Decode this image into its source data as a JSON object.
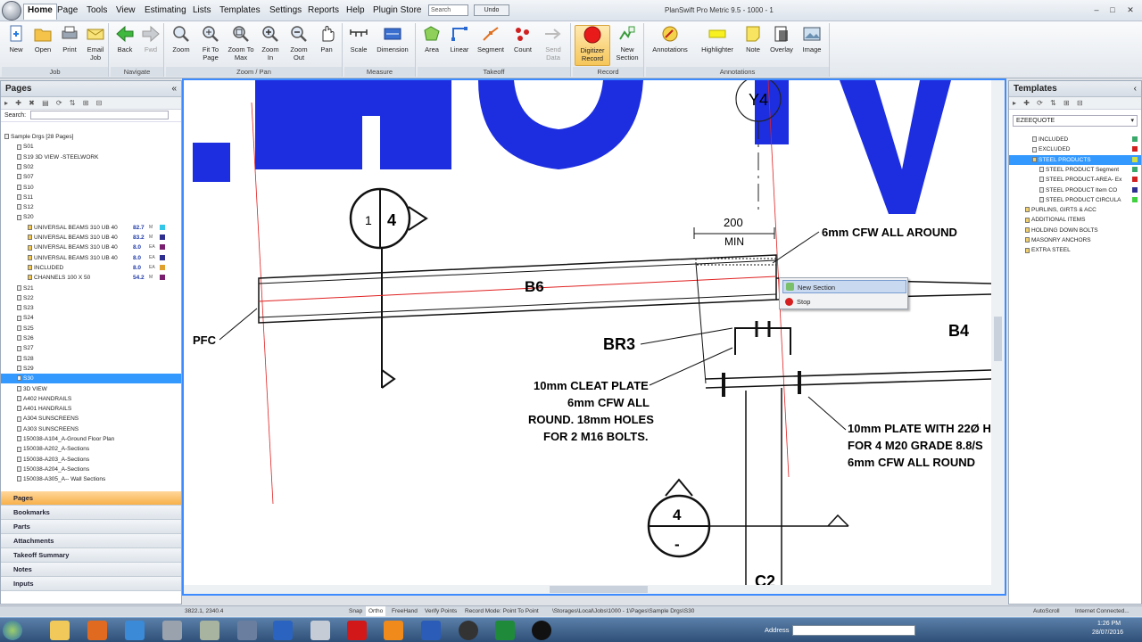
{
  "app": {
    "title": "PlanSwift Pro Metric 9.5 - 1000 - 1"
  },
  "menus": [
    "Home",
    "Page",
    "Tools",
    "View",
    "Estimating",
    "Lists",
    "Templates",
    "Settings",
    "Reports",
    "Help",
    "Plugin Store"
  ],
  "search": {
    "placeholder": "Search"
  },
  "undo_label": "Undo",
  "ribbon": {
    "groups": [
      {
        "label": "Job",
        "buttons": [
          "New",
          "Open",
          "Print",
          "Email Job"
        ]
      },
      {
        "label": "Navigate",
        "buttons": [
          "Back",
          "Fwd"
        ]
      },
      {
        "label": "Zoom / Pan",
        "buttons": [
          "Zoom",
          "Fit To Page",
          "Zoom To Max",
          "Zoom In",
          "Zoom Out",
          "Pan"
        ]
      },
      {
        "label": "Measure",
        "buttons": [
          "Scale",
          "Dimension"
        ]
      },
      {
        "label": "Takeoff",
        "buttons": [
          "Area",
          "Linear",
          "Segment",
          "Count",
          "Send Data"
        ]
      },
      {
        "label": "Record",
        "buttons": [
          "Digitizer Record",
          "New Section"
        ]
      },
      {
        "label": "Annotations",
        "buttons": [
          "Annotations",
          "Highlighter",
          "Note",
          "Overlay",
          "Image"
        ]
      }
    ]
  },
  "pages_panel": {
    "title": "Pages",
    "search_label": "Search:",
    "tree": [
      {
        "label": "Sample Drgs [28 Pages]"
      },
      {
        "label": "S01"
      },
      {
        "label": "S19 3D VIEW -STEELWORK"
      },
      {
        "label": "S02"
      },
      {
        "label": "S07"
      },
      {
        "label": "S10"
      },
      {
        "label": "S11"
      },
      {
        "label": "S12"
      },
      {
        "label": "S20"
      },
      {
        "label": "UNIVERSAL BEAMS 310 UB 40",
        "value": "82.7",
        "unit": "M",
        "color": "#33c6e8"
      },
      {
        "label": "UNIVERSAL BEAMS 310 UB 40",
        "value": "83.2",
        "unit": "M",
        "color": "#2f2f8f"
      },
      {
        "label": "UNIVERSAL BEAMS 310 UB 40",
        "value": "8.0",
        "unit": "EA",
        "color": "#7a1f6f"
      },
      {
        "label": "UNIVERSAL BEAMS 310 UB 40",
        "value": "8.0",
        "unit": "EA",
        "color": "#2f2f8f"
      },
      {
        "label": "INCLUDED",
        "value": "8.0",
        "unit": "EA",
        "color": "#e0a030"
      },
      {
        "label": "CHANNELS 100 X 50",
        "value": "54.2",
        "unit": "M",
        "color": "#7a1f6f"
      },
      {
        "label": "S21"
      },
      {
        "label": "S22"
      },
      {
        "label": "S23"
      },
      {
        "label": "S24"
      },
      {
        "label": "S25"
      },
      {
        "label": "S26"
      },
      {
        "label": "S27"
      },
      {
        "label": "S28"
      },
      {
        "label": "S29"
      },
      {
        "label": "S30"
      },
      {
        "label": "3D VIEW"
      },
      {
        "label": "A402 HANDRAILS"
      },
      {
        "label": "A401 HANDRAILS"
      },
      {
        "label": "A304 SUNSCREENS"
      },
      {
        "label": "A303 SUNSCREENS"
      },
      {
        "label": "150038-A104_A-Ground Floor Plan"
      },
      {
        "label": "150038-A202_A-Sections"
      },
      {
        "label": "150038-A203_A-Sections"
      },
      {
        "label": "150038-A204_A-Sections"
      },
      {
        "label": "150038-A305_A-- Wall Sections"
      }
    ],
    "accordion": [
      "Pages",
      "Bookmarks",
      "Parts",
      "Attachments",
      "Takeoff Summary",
      "Notes",
      "Inputs"
    ]
  },
  "templates_panel": {
    "title": "Templates",
    "dropdown": "EZEEQUOTE",
    "tree": [
      {
        "label": "INCLUDED",
        "color": "#3aa86a"
      },
      {
        "label": "EXCLUDED",
        "color": "#d02020"
      },
      {
        "label": "STEEL PRODUCTS",
        "color": "#d0e040"
      },
      {
        "label": "STEEL PRODUCT Segment",
        "color": "#3aa86a"
      },
      {
        "label": "STEEL PRODUCT-AREA- Ex",
        "color": "#d02020"
      },
      {
        "label": "STEEL PRODUCT  Item CO",
        "color": "#2f2f8f"
      },
      {
        "label": "STEEL PRODUCT CIRCULA",
        "color": "#40d040"
      },
      {
        "label": "PURLINS, GIRTS & ACC"
      },
      {
        "label": "ADDITIONAL ITEMS"
      },
      {
        "label": "HOLDING DOWN BOLTS"
      },
      {
        "label": "MASONRY ANCHORS"
      },
      {
        "label": "EXTRA STEEL"
      }
    ]
  },
  "drawing": {
    "labels": {
      "y4": "Y4",
      "dim200": "200",
      "min": "MIN",
      "cfw_around": "6mm CFW ALL AROUND",
      "b6": "B6",
      "pfc": "PFC",
      "br3": "BR3",
      "b4": "B4",
      "cleat1": "10mm CLEAT PLATE",
      "cleat2": "6mm CFW ALL",
      "cleat3": "ROUND. 18mm HOLES",
      "cleat4": "FOR 2 M16 BOLTS.",
      "plate1": "10mm PLATE WITH 22Ø H",
      "plate2": "FOR 4 M20 GRADE 8.8/S",
      "plate3": "6mm CFW ALL ROUND",
      "c2": "C2",
      "sec1": "1",
      "sec4": "4",
      "sec4b": "4",
      "sec_dash": "-"
    }
  },
  "context_menu": {
    "items": [
      "New Section",
      "Stop"
    ]
  },
  "status": {
    "coords": "3822.1, 2340.4",
    "snap": "Snap",
    "ortho": "Ortho",
    "freehand": "FreeHand",
    "verify": "Verify Points",
    "record_mode": "Record Mode: Point To Point",
    "path": "\\Storages\\Local\\Jobs\\1000 - 1\\Pages\\Sample Drgs\\S30",
    "autoscroll": "AutoScroll",
    "internet": "Internet Connected..."
  },
  "taskbar": {
    "address_label": "Address",
    "time": "1:26 PM",
    "date": "28/07/2016"
  }
}
